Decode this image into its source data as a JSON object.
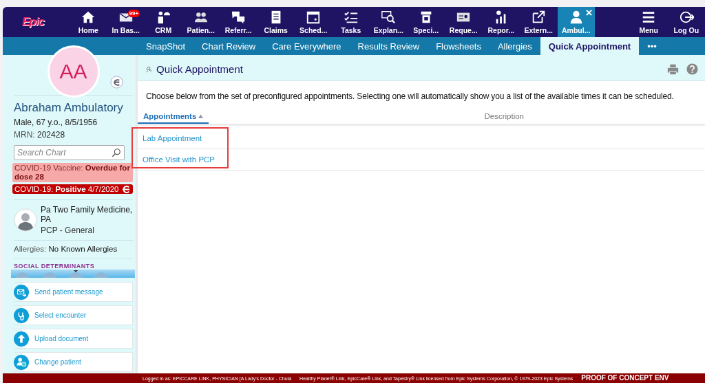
{
  "nav": {
    "logo": "Epic",
    "items": [
      {
        "label": "Home",
        "selected": false
      },
      {
        "label": "In Bas...",
        "selected": false,
        "badge": "99+"
      },
      {
        "label": "CRM",
        "selected": false
      },
      {
        "label": "Patien...",
        "selected": false
      },
      {
        "label": "Referr...",
        "selected": false
      },
      {
        "label": "Claims",
        "selected": false
      },
      {
        "label": "Sched...",
        "selected": false
      },
      {
        "label": "Tasks",
        "selected": false
      },
      {
        "label": "Explan...",
        "selected": false
      },
      {
        "label": "Speci...",
        "selected": false
      },
      {
        "label": "Reque...",
        "selected": false
      },
      {
        "label": "Repor...",
        "selected": false
      },
      {
        "label": "Extern...",
        "selected": false
      },
      {
        "label": "Ambul...",
        "selected": true,
        "closable": true
      }
    ],
    "right": [
      "Menu",
      "Log Ou"
    ]
  },
  "tabs": [
    {
      "label": "SnapShot",
      "selected": false
    },
    {
      "label": "Chart Review",
      "selected": false
    },
    {
      "label": "Care Everywhere",
      "selected": false
    },
    {
      "label": "Results Review",
      "selected": false
    },
    {
      "label": "Flowsheets",
      "selected": false
    },
    {
      "label": "Allergies",
      "selected": false
    },
    {
      "label": "Quick Appointment",
      "selected": true
    },
    {
      "label": "•••",
      "selected": false
    }
  ],
  "patient": {
    "initials": "AA",
    "name": "Abraham Ambulatory",
    "details": "Male, 67 y.o., 8/5/1956",
    "mrn_label": "MRN:",
    "mrn": "202428",
    "search": {
      "placeholder": "Search Chart"
    },
    "alerts": [
      {
        "kind": "warning",
        "text": "COVID-19 Vaccine: **Overdue for dose 28**"
      },
      {
        "kind": "critical",
        "text": "COVID-19: **Positive** 4/7/2020"
      }
    ],
    "pcp": {
      "name": "Pa Two Family Medicine, PA",
      "role": "PCP - General"
    },
    "allergies_label": "Allergies:",
    "allergies": "No Known Allergies",
    "social_determinants": "SOCIAL DETERMINANTS"
  },
  "actions": [
    "Send patient message",
    "Select encounter",
    "Upload document",
    "Change patient"
  ],
  "page": {
    "title": "Quick Appointment",
    "intro": "Choose below from the set of preconfigured appointments. Selecting one will automatically show you a list of the available times it can be scheduled.",
    "columns": [
      {
        "label": "Appointments",
        "sorted": true
      },
      {
        "label": "Description",
        "sorted": false
      }
    ],
    "rows": [
      "Lab Appointment",
      "Office Visit with PCP"
    ],
    "highlight_box": true
  },
  "footer": {
    "login": "Logged in as: EPICCARE LINK, PHYSICIAN [A Lady's Doctor - Chula",
    "license": "Healthy Planet® Link, EpicCare® Link, and Tapestry® Link licensed from Epic Systems Corporation, © 1979-2023 Epic Systems",
    "env": "PROOF OF CONCEPT ENV"
  }
}
